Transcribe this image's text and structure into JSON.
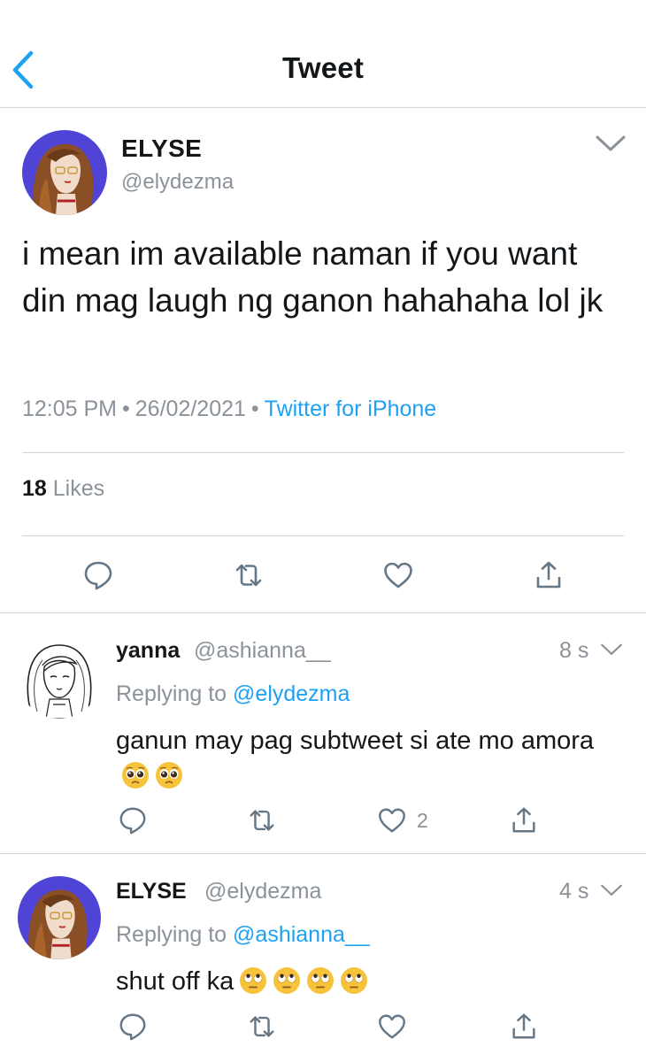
{
  "header": {
    "title": "Tweet"
  },
  "tweet": {
    "name": "ELYSE",
    "handle": "@elydezma",
    "text": "i mean im available naman if you want din mag laugh ng ganon hahahaha lol jk",
    "time": "12:05 PM",
    "separator": "•",
    "date": "26/02/2021",
    "source": "Twitter for iPhone",
    "likes_count": "18",
    "likes_label": "Likes"
  },
  "replies": [
    {
      "name": "yanna",
      "handle": "@ashianna__",
      "time": "8 s",
      "replying_label": "Replying to",
      "replying_to": "@elydezma",
      "text": "ganun may pag subtweet si ate mo amora",
      "emojis": [
        "pleading-face",
        "pleading-face"
      ],
      "like_count": "2"
    },
    {
      "name": "ELYSE",
      "handle": "@elydezma",
      "time": "4 s",
      "replying_label": "Replying to",
      "replying_to": "@ashianna__",
      "text": "shut off ka",
      "emojis": [
        "eye-roll-face",
        "eye-roll-face",
        "eye-roll-face",
        "eye-roll-face"
      ]
    }
  ],
  "colors": {
    "accent": "#1da1f2",
    "muted": "#8b929a",
    "text": "#14171a",
    "divider": "#d3d3d6",
    "avatar_bg": "#4f44d6"
  },
  "icons": [
    "back-chevron-icon",
    "chevron-down-icon",
    "reply-icon",
    "retweet-icon",
    "heart-icon",
    "share-icon"
  ]
}
